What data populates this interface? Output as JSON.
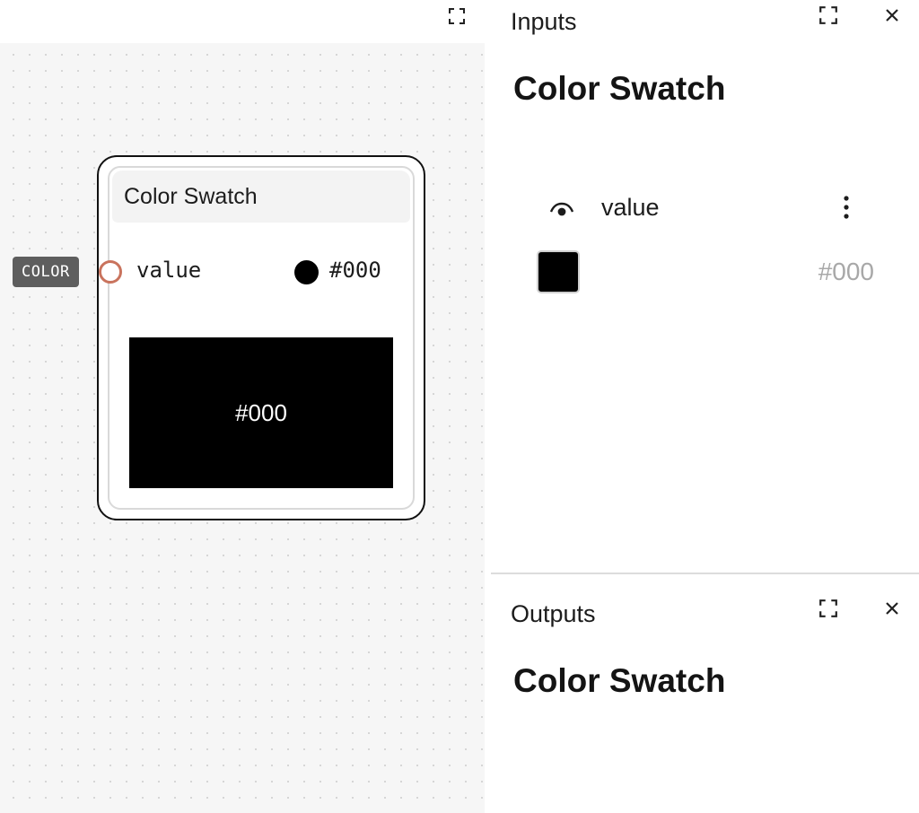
{
  "canvas": {
    "expand_icon": "expand-icon",
    "node": {
      "title": "Color Swatch",
      "input_type_tag": "COLOR",
      "field": {
        "label": "value",
        "value": "#000",
        "color": "#000000"
      },
      "preview_text": "#000"
    }
  },
  "inputs_panel": {
    "title": "Inputs",
    "heading": "Color Swatch",
    "field_label": "value",
    "color_value": "#000",
    "swatch_color": "#000000",
    "visibility_icon": "eye-icon",
    "menu_icon": "more-vertical-icon",
    "expand_icon": "expand-icon",
    "close_icon": "close-icon"
  },
  "outputs_panel": {
    "title": "Outputs",
    "heading": "Color Swatch",
    "expand_icon": "expand-icon",
    "close_icon": "close-icon"
  },
  "colors": {
    "port_border": "#c9735d",
    "tag_bg": "#5e5e5e",
    "canvas_bg": "#f6f6f6"
  }
}
